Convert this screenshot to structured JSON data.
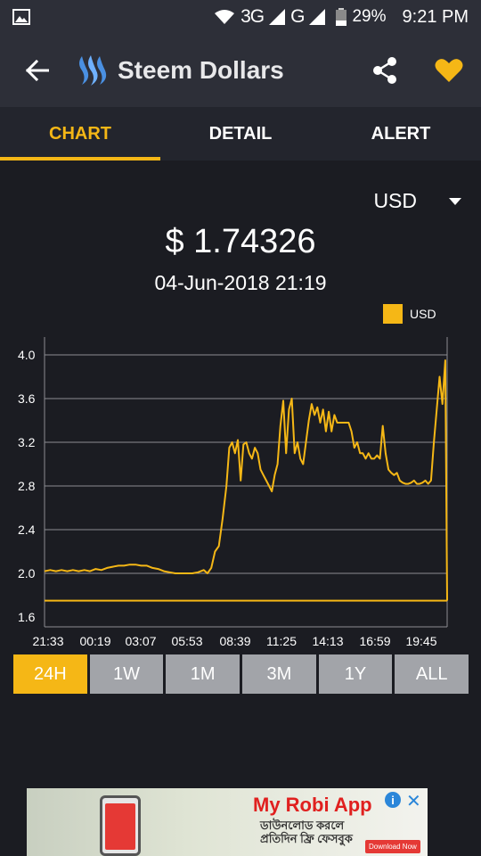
{
  "status": {
    "network": "3G",
    "network2": "G",
    "battery": "29%",
    "time": "9:21 PM"
  },
  "header": {
    "title": "Steem Dollars"
  },
  "tabs": [
    {
      "label": "CHART"
    },
    {
      "label": "DETAIL"
    },
    {
      "label": "ALERT"
    }
  ],
  "currency": {
    "selected": "USD"
  },
  "price": {
    "value": "$ 1.74326",
    "datetime": "04-Jun-2018 21:19"
  },
  "colors": {
    "accent": "#f5b716",
    "background": "#1b1c22",
    "bar": "#2d2f38"
  },
  "chart_data": {
    "type": "line",
    "series": [
      {
        "name": "USD",
        "color": "#f5b716"
      }
    ],
    "x": [
      "21:33",
      "00:19",
      "03:07",
      "05:53",
      "08:39",
      "11:25",
      "14:13",
      "16:59",
      "19:45"
    ],
    "ylim": [
      1.6,
      4.2
    ],
    "yticks": [
      "4.0",
      "3.6",
      "3.2",
      "2.8",
      "2.4",
      "2.0",
      "1.6"
    ],
    "points": [
      [
        0,
        2.02
      ],
      [
        6,
        2.03
      ],
      [
        12,
        2.02
      ],
      [
        18,
        2.03
      ],
      [
        24,
        2.02
      ],
      [
        30,
        2.03
      ],
      [
        36,
        2.02
      ],
      [
        42,
        2.03
      ],
      [
        48,
        2.02
      ],
      [
        54,
        2.04
      ],
      [
        60,
        2.03
      ],
      [
        66,
        2.05
      ],
      [
        72,
        2.06
      ],
      [
        78,
        2.07
      ],
      [
        84,
        2.07
      ],
      [
        90,
        2.08
      ],
      [
        96,
        2.08
      ],
      [
        102,
        2.07
      ],
      [
        108,
        2.07
      ],
      [
        114,
        2.05
      ],
      [
        120,
        2.04
      ],
      [
        126,
        2.02
      ],
      [
        132,
        2.01
      ],
      [
        138,
        2.0
      ],
      [
        144,
        2.0
      ],
      [
        150,
        2.0
      ],
      [
        156,
        2.0
      ],
      [
        162,
        2.01
      ],
      [
        168,
        2.03
      ],
      [
        172,
        2.0
      ],
      [
        176,
        2.05
      ],
      [
        180,
        2.2
      ],
      [
        184,
        2.25
      ],
      [
        188,
        2.5
      ],
      [
        192,
        2.8
      ],
      [
        195,
        3.15
      ],
      [
        198,
        3.2
      ],
      [
        201,
        3.1
      ],
      [
        204,
        3.22
      ],
      [
        207,
        2.85
      ],
      [
        210,
        3.18
      ],
      [
        213,
        3.2
      ],
      [
        216,
        3.1
      ],
      [
        219,
        3.05
      ],
      [
        222,
        3.15
      ],
      [
        225,
        3.1
      ],
      [
        228,
        2.95
      ],
      [
        231,
        2.9
      ],
      [
        234,
        2.85
      ],
      [
        237,
        2.8
      ],
      [
        240,
        2.75
      ],
      [
        243,
        2.9
      ],
      [
        246,
        3.0
      ],
      [
        249,
        3.35
      ],
      [
        252,
        3.58
      ],
      [
        255,
        3.1
      ],
      [
        258,
        3.5
      ],
      [
        261,
        3.6
      ],
      [
        264,
        3.1
      ],
      [
        267,
        3.2
      ],
      [
        270,
        3.05
      ],
      [
        273,
        3.0
      ],
      [
        276,
        3.2
      ],
      [
        279,
        3.4
      ],
      [
        282,
        3.55
      ],
      [
        285,
        3.45
      ],
      [
        288,
        3.52
      ],
      [
        291,
        3.38
      ],
      [
        294,
        3.5
      ],
      [
        297,
        3.3
      ],
      [
        300,
        3.48
      ],
      [
        303,
        3.3
      ],
      [
        306,
        3.45
      ],
      [
        309,
        3.38
      ],
      [
        315,
        3.38
      ],
      [
        321,
        3.38
      ],
      [
        324,
        3.3
      ],
      [
        327,
        3.15
      ],
      [
        330,
        3.2
      ],
      [
        333,
        3.1
      ],
      [
        336,
        3.1
      ],
      [
        339,
        3.05
      ],
      [
        342,
        3.1
      ],
      [
        345,
        3.05
      ],
      [
        348,
        3.05
      ],
      [
        351,
        3.08
      ],
      [
        354,
        3.05
      ],
      [
        357,
        3.35
      ],
      [
        360,
        3.1
      ],
      [
        363,
        2.95
      ],
      [
        366,
        2.92
      ],
      [
        369,
        2.9
      ],
      [
        372,
        2.92
      ],
      [
        375,
        2.85
      ],
      [
        378,
        2.83
      ],
      [
        381,
        2.82
      ],
      [
        384,
        2.82
      ],
      [
        387,
        2.83
      ],
      [
        390,
        2.85
      ],
      [
        393,
        2.82
      ],
      [
        396,
        2.82
      ],
      [
        399,
        2.83
      ],
      [
        402,
        2.85
      ],
      [
        405,
        2.82
      ],
      [
        408,
        2.85
      ],
      [
        411,
        3.2
      ],
      [
        414,
        3.5
      ],
      [
        417,
        3.8
      ],
      [
        420,
        3.55
      ],
      [
        423,
        3.95
      ],
      [
        425,
        1.75
      ]
    ],
    "reference": 1.75
  },
  "ranges": [
    {
      "label": "24H"
    },
    {
      "label": "1W"
    },
    {
      "label": "1M"
    },
    {
      "label": "3M"
    },
    {
      "label": "1Y"
    },
    {
      "label": "ALL"
    }
  ],
  "ad": {
    "title": "My Robi App",
    "line1": "ডাউনলোড করলে",
    "line2": "প্রতিদিন ফ্রি ফেসবুক",
    "cta": "Download Now",
    "info": "i",
    "close": "✕"
  }
}
